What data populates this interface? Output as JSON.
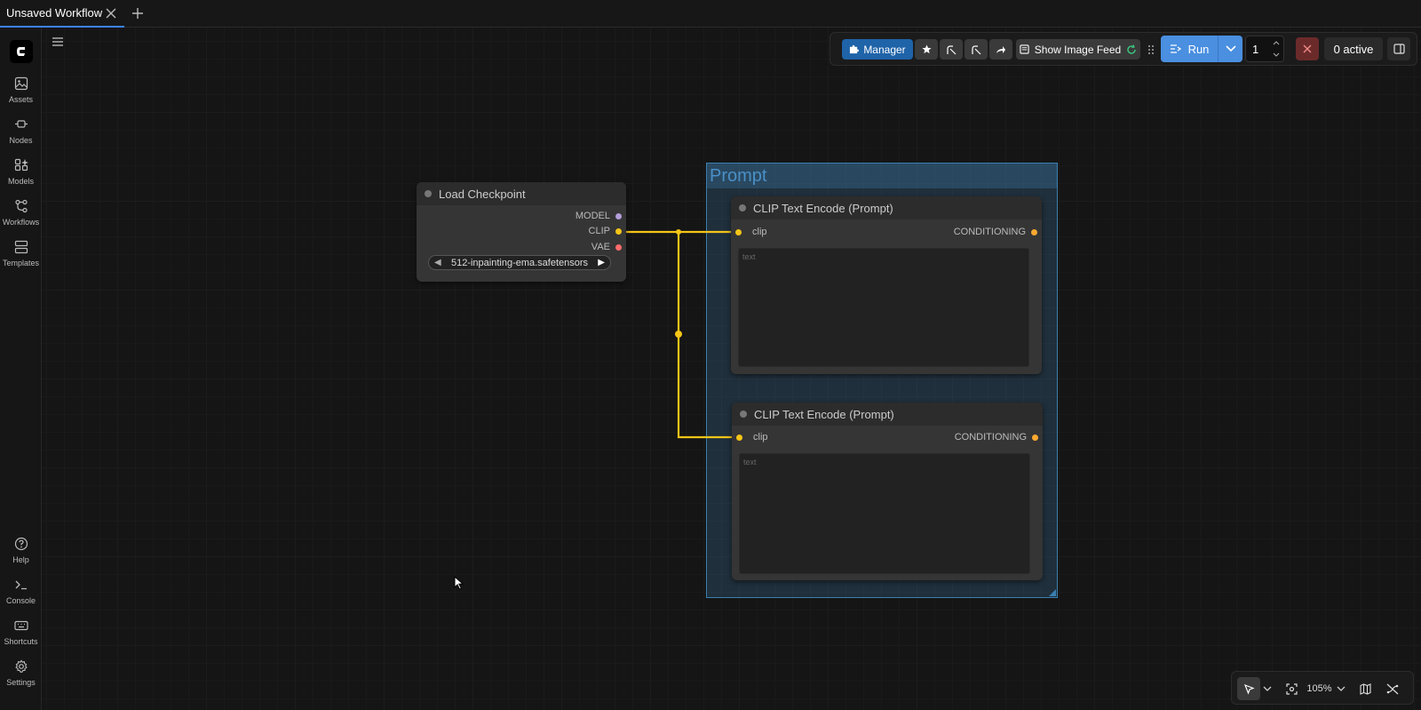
{
  "tabs": [
    {
      "label": "Unsaved Workflow"
    }
  ],
  "sidebar": {
    "top": [
      {
        "label": "Assets",
        "icon": "image-icon"
      },
      {
        "label": "Nodes",
        "icon": "node-icon"
      },
      {
        "label": "Models",
        "icon": "models-icon"
      },
      {
        "label": "Workflows",
        "icon": "workflow-icon"
      },
      {
        "label": "Templates",
        "icon": "template-icon"
      }
    ],
    "bottom": [
      {
        "label": "Help",
        "icon": "help-icon"
      },
      {
        "label": "Console",
        "icon": "terminal-icon"
      },
      {
        "label": "Shortcuts",
        "icon": "keyboard-icon"
      },
      {
        "label": "Settings",
        "icon": "gear-icon"
      }
    ]
  },
  "toolbar": {
    "manager_label": "Manager",
    "feed_label": "Show Image Feed",
    "run_label": "Run",
    "queue_count": "1",
    "active_label": "0 active"
  },
  "nodes": {
    "load_checkpoint": {
      "title": "Load Checkpoint",
      "outputs": [
        "MODEL",
        "CLIP",
        "VAE"
      ],
      "ckpt_value": "512-inpainting-ema.safetensors"
    },
    "clip1": {
      "title": "CLIP Text Encode (Prompt)",
      "input": "clip",
      "output": "CONDITIONING",
      "placeholder": "text"
    },
    "clip2": {
      "title": "CLIP Text Encode (Prompt)",
      "input": "clip",
      "output": "CONDITIONING",
      "placeholder": "text"
    }
  },
  "group": {
    "title": "Prompt",
    "color": "#3a7fb0"
  },
  "canvas_controls": {
    "zoom": "105%"
  },
  "colors": {
    "clip_link": "#f5c518",
    "model_pin": "#b39ddb",
    "vae_pin": "#ff6b6b",
    "conditioning_pin": "#ffa931",
    "accent": "#4a8fe0"
  }
}
